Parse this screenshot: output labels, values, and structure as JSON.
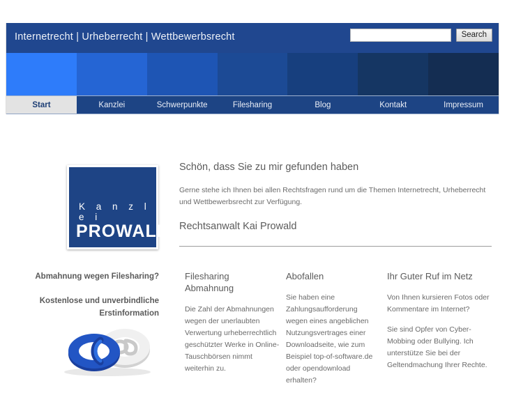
{
  "header": {
    "title": "Internetrecht | Urheberrecht | Wettbewerbsrecht",
    "search": {
      "value": "",
      "placeholder": "",
      "button_label": "Search"
    },
    "background_color": "#20478f"
  },
  "banner": {
    "blocks": [
      {
        "color": "#2e7cfa"
      },
      {
        "color": "#2565d4"
      },
      {
        "color": "#1e55b4"
      },
      {
        "color": "#1c4a95"
      },
      {
        "color": "#173f7e"
      },
      {
        "color": "#153663"
      },
      {
        "color": "#142d52"
      }
    ]
  },
  "nav": {
    "items": [
      {
        "label": "Start",
        "active": true
      },
      {
        "label": "Kanzlei",
        "active": false
      },
      {
        "label": "Schwerpunkte",
        "active": false
      },
      {
        "label": "Filesharing",
        "active": false
      },
      {
        "label": "Blog",
        "active": false
      },
      {
        "label": "Kontakt",
        "active": false
      },
      {
        "label": "Impressum",
        "active": false
      }
    ],
    "background_color": "#1d4484",
    "active_background_color": "#e3e3e3"
  },
  "logo": {
    "line1": "K a n z l e i",
    "line2": "PROWALD",
    "background_color": "#1e4485"
  },
  "intro": {
    "heading": "Schön, dass Sie zu mir gefunden haben",
    "paragraph": "Gerne stehe ich Ihnen bei allen Rechtsfragen rund um die Themen Internetrecht, Urheberrecht und Wettbewerbsrecht zur Verfügung.",
    "name": "Rechtsanwalt Kai Prowald"
  },
  "promo": {
    "line1": "Abmahnung wegen Filesharing?",
    "line2": "Kostenlose und unverbindliche Erstinformation"
  },
  "columns": [
    {
      "heading": "Filesharing Abmahnung",
      "body": "Die Zahl der Abmahnungen wegen der unerlaubten Verwertung urheberrechtlich geschützter Werke in Online-Tauschbörsen nimmt weiterhin zu."
    },
    {
      "heading": "Abofallen",
      "body": "Sie haben eine Zahlungsaufforderung wegen eines angeblichen Nutzungsvertrages einer Downloadseite, wie zum Beispiel top-of-software.de oder opendownload erhalten?"
    },
    {
      "heading": "Ihr Guter Ruf im Netz",
      "body1": "Von Ihnen kursieren Fotos oder Kommentare im Internet?",
      "body2": "Sie sind Opfer von Cyber-Mobbing oder Bullying. Ich unterstütze Sie bei der Geltendmachung Ihrer Rechte."
    }
  ]
}
